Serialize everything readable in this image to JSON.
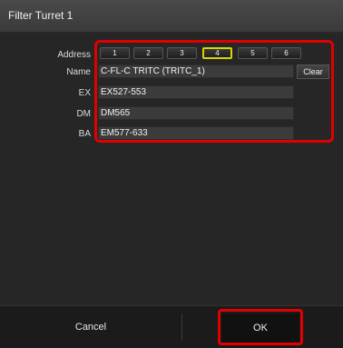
{
  "window": {
    "title": "Filter Turret 1"
  },
  "labels": {
    "address": "Address",
    "name": "Name",
    "ex": "EX",
    "dm": "DM",
    "ba": "BA"
  },
  "address_buttons": [
    {
      "label": "1",
      "selected": false
    },
    {
      "label": "2",
      "selected": false
    },
    {
      "label": "3",
      "selected": false
    },
    {
      "label": "4",
      "selected": true
    },
    {
      "label": "5",
      "selected": false
    },
    {
      "label": "6",
      "selected": false
    }
  ],
  "fields": {
    "name": "C-FL-C TRITC (TRITC_1)",
    "ex": "EX527-553",
    "dm": "DM565",
    "ba": "EM577-633"
  },
  "buttons": {
    "clear": "Clear",
    "cancel": "Cancel",
    "ok": "OK"
  },
  "colors": {
    "selected_outline": "#d7d400",
    "annotation": "#e00000"
  }
}
